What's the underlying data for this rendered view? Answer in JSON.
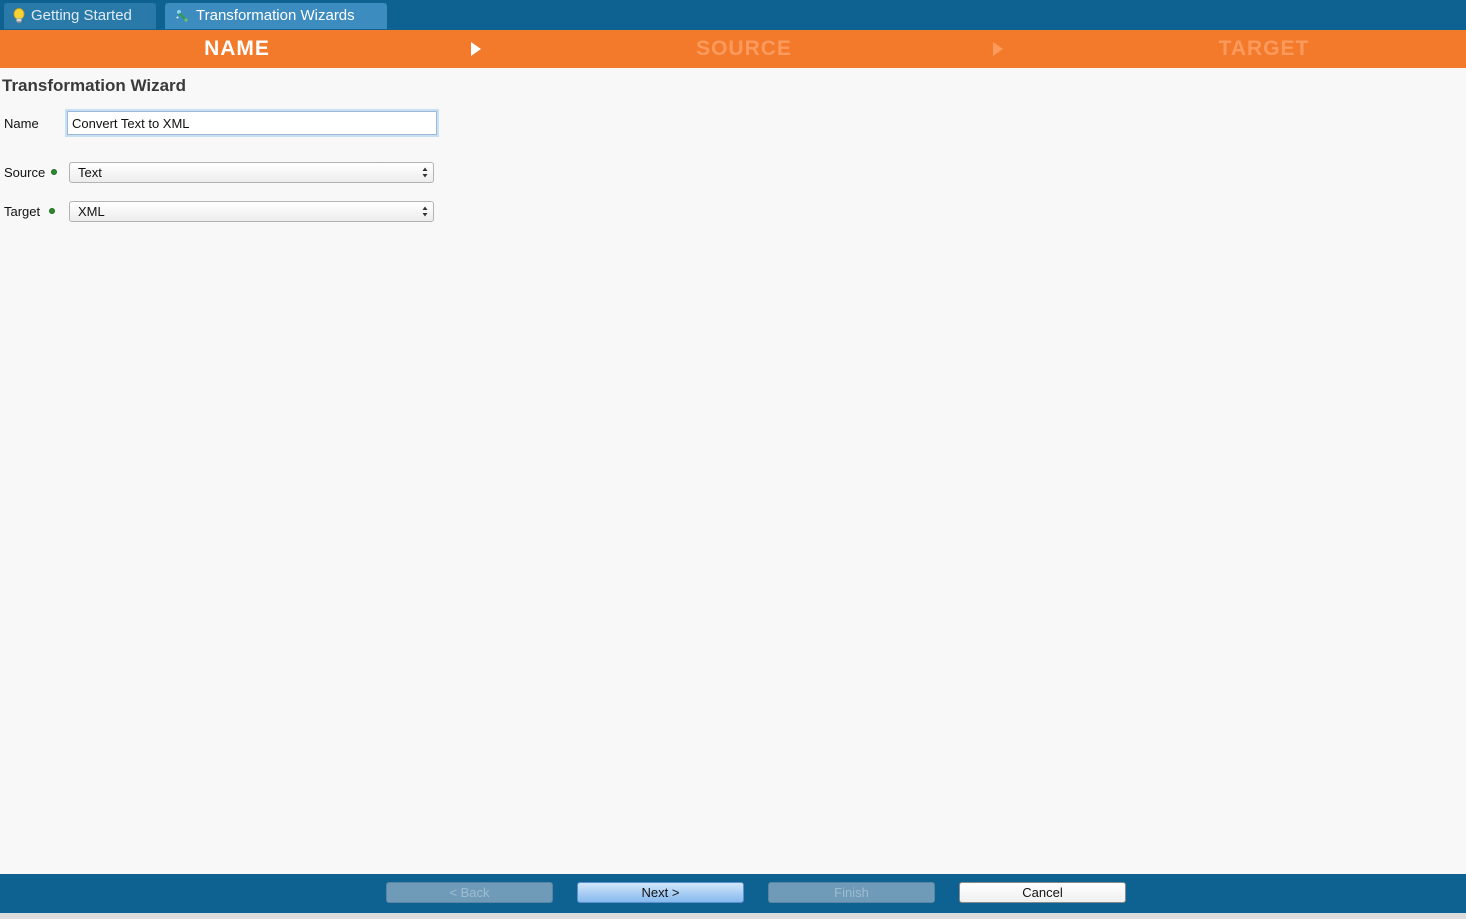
{
  "tabs": [
    {
      "label": "Getting Started",
      "icon": "lightbulb-icon",
      "active": false
    },
    {
      "label": "Transformation Wizards",
      "icon": "wizard-icon",
      "active": true
    }
  ],
  "steps": [
    {
      "label": "NAME",
      "active": true
    },
    {
      "label": "SOURCE",
      "active": false
    },
    {
      "label": "TARGET",
      "active": false
    }
  ],
  "form": {
    "title": "Transformation Wizard",
    "name_label": "Name",
    "name_value": "Convert Text to XML",
    "source_label": "Source",
    "source_value": "Text",
    "target_label": "Target",
    "target_value": "XML"
  },
  "buttons": {
    "back": "< Back",
    "next": "Next >",
    "finish": "Finish",
    "cancel": "Cancel"
  },
  "colors": {
    "header_blue": "#0e6291",
    "step_orange": "#f47a2b",
    "required_dot": "#2e8b2e"
  }
}
